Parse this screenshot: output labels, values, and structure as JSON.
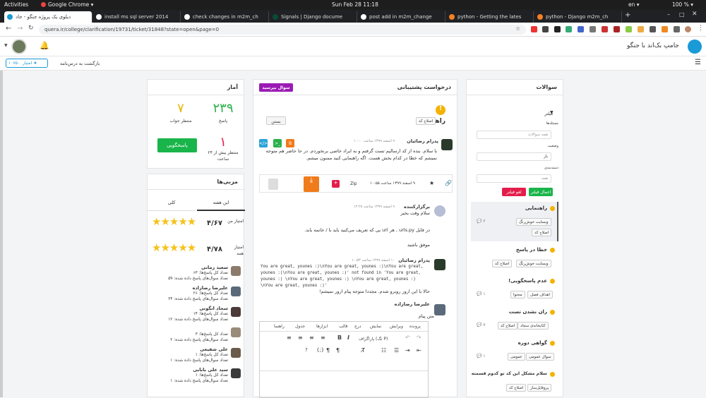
{
  "os": {
    "activities": "Activities",
    "app": "Google Chrome ▾",
    "clock": "Sun Feb 28  11:18",
    "lang": "en ▾",
    "battery": "100 % ▾"
  },
  "tabs": [
    "دیلوی یک پروژه جنگو - جاد",
    "install ms sql server 2014",
    "check changes in m2m_ch",
    "Signals | Django docume",
    "post add in m2m_change",
    "python - Getting the lates",
    "python - Django m2m_ch"
  ],
  "url": "quera.ir/college/clarification/19731/ticket/31848?state=open&page=0",
  "site": {
    "title": "جامپ بک‌اند با جنگو",
    "menu": "☰"
  },
  "subbar": {
    "back": "بازگشت به درس‌نامه",
    "score_label": "امتیاز",
    "score": "۱۰۷۵۰"
  },
  "stats": {
    "title": "آمار",
    "answered": "۲۳۹",
    "answered_label": "پاسخ",
    "waiting": "۷",
    "waiting_label": "منتظر جواب",
    "overdue": "۱",
    "overdue_label": "منتظر بیش از ۲۴ ساعت",
    "answer_btn": "پاسخگویی"
  },
  "mentors": {
    "title": "مربی‌ها",
    "tab_week": "این هفته",
    "tab_all": "کلی",
    "my_score_label": "امتیاز من",
    "my_score": "۴/۶۷",
    "all_score_label": "امتیاز همه",
    "all_score": "۴/۷۸",
    "people": [
      {
        "name": "سعید زمانی",
        "l1": "تعداد کل پاسخ‌ها: ۶۳",
        "l2": "تعداد سوال‌های پاسخ داده شده: ۵۹"
      },
      {
        "name": "علیرضا رضازاده",
        "l1": "تعداد کل پاسخ‌ها: ۲۶",
        "l2": "تعداد سوال‌های پاسخ داده شده: ۲۴"
      },
      {
        "name": "سجاد انگوتی",
        "l1": "تعداد کل پاسخ‌ها: ۱۴",
        "l2": "تعداد سوال‌های پاسخ داده شده: ۱۲"
      },
      {
        "name": "",
        "l1": "تعداد کل پاسخ‌ها: ۳",
        "l2": "تعداد سوال‌های پاسخ داده شده: ۲"
      },
      {
        "name": "علی شفیعی",
        "l1": "تعداد کل پاسخ‌ها: ۱",
        "l2": "تعداد سوال‌های پاسخ داده شده: ۱"
      },
      {
        "name": "سید علی بابایی",
        "l1": "تعداد کل پاسخ‌ها: ۱",
        "l2": "تعداد سوال‌های پاسخ داده شده: ۱"
      }
    ]
  },
  "ticket": {
    "head": "درخواست پشتیبانی",
    "ask_btn": "سوال بپرسید",
    "title": "راهنمایی",
    "title_tag": "اصلاح کد",
    "close_btn": "بستن",
    "m1_author": "پدرام رضائیان",
    "m1_date": "۹ اسفند ۱۳۹۹ ساعت ۱۰:۰۰",
    "m1_text": "با سلام. بنده از کد ارسالیم تست گرفتم و به ایراد خاصی برنخوردم. در حا حاضر هم متوجه نمیشم که خطا در کدام بخش هست. اگه راهنمایی کنید ممنون میشم.",
    "file_date": "۹ اسفند ۱۳۹۹ ساعت ۱۰:۵۵",
    "file_type": "Zip",
    "m2_author": "برگزارکننده",
    "m2_date": "۹ اسفند ۱۳۹۹ ساعت ۱۲:۲۸",
    "m2_l1": "سلام وقت بخیر",
    "m2_l2": "در فایل urls.py , هر url یی که تعریف می‌کنید باید با / خاتمه یابد.",
    "m2_l3": "موفق باشید",
    "m3_author": "پدرام رضائیان",
    "m3_date": "۱۰ اسفند ۱۳۹۹ ساعت ۱۰:۵۳",
    "m3_code": "You are great, younes :)\\nYou are great, younes :)\\nYou are great, younes :)\\nYou are great, younes :)' not found in 'You are great, younes :) \\nYou are great, younes :) \\nYou are great, younes :) \\nYou are great, younes :)'",
    "m3_text": "حالا با این ارور روبرو شدم. مجددا متوجه پیام ارور نمیشم!",
    "editor_author": "علیرضا رضازاده",
    "editor_label": "متن پیام",
    "editor_menu": [
      "پرونده",
      "ویرایش",
      "نمایش",
      "درج",
      "قالب",
      "ابزارها",
      "جدول",
      "راهنما"
    ],
    "paragraph": "پاراگراف (تگ P)"
  },
  "questions": {
    "title": "سوالات",
    "filter": "فیلتر",
    "f1_label": "مسئله‌ها",
    "f1_ph": "همه سوالات",
    "f2_label": "وضعیت",
    "f2_val": "باز",
    "f3_label": "دسته‌بندی",
    "f3_ph": "همه",
    "apply": "اعمال فیلتر",
    "clear": "لغو فیلتر",
    "items": [
      {
        "title": "راهنمایی",
        "tags": [
          "وبسایت خوش‌رنگ",
          "اصلاح کد"
        ],
        "count": "۲"
      },
      {
        "title": "خطا در پاسخ",
        "tags": [
          "وبسایت خوش‌رنگ",
          "اصلاح کد"
        ],
        "count": ""
      },
      {
        "title": "عدم پاسخگویی!",
        "tags": [
          "اهداف فصل",
          "محتوا"
        ],
        "count": "۱"
      },
      {
        "title": "ران نشدن تست",
        "tags": [
          "کتابخانه‌ی سجاد",
          "اصلاح کد"
        ],
        "count": "۷"
      },
      {
        "title": "گواهی دوره",
        "tags": [
          "سوال عمومی",
          "عمومی"
        ],
        "count": "۱"
      },
      {
        "title": "سلام مشکل این کد تو کدوم قسمته",
        "tags": [
          "پروفایل‌ساز",
          "اصلاح کد"
        ],
        "count": ""
      }
    ]
  }
}
